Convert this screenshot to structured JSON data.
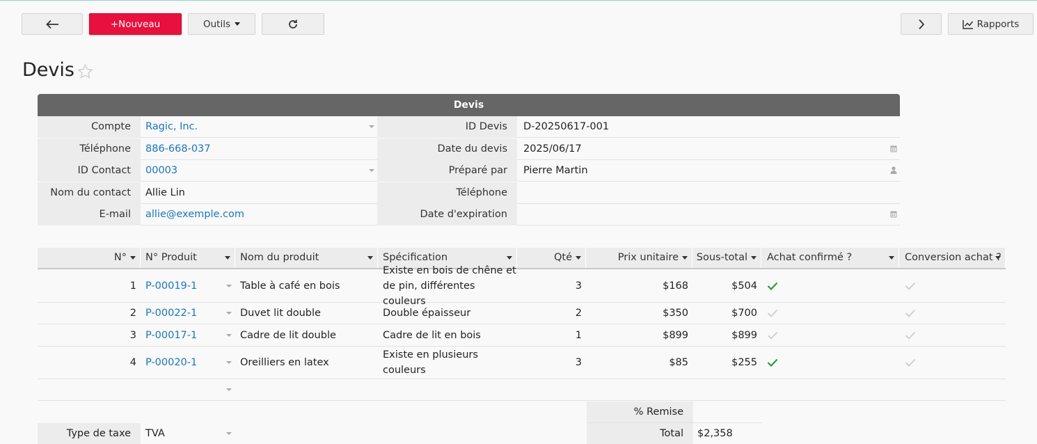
{
  "toolbar": {
    "back_icon": "arrow-left-icon",
    "new_label": "+Nouveau",
    "tools_label": "Outils",
    "refresh_icon": "refresh-icon",
    "next_icon": "chevron-right-icon",
    "reports_label": "Rapports",
    "reports_icon": "line-chart-icon"
  },
  "page": {
    "title": "Devis",
    "favorite_icon": "star-icon"
  },
  "section": {
    "title": "Devis"
  },
  "fields": {
    "compte": {
      "label": "Compte",
      "value": "Ragic, Inc."
    },
    "telephone": {
      "label": "Téléphone",
      "value": "886-668-037"
    },
    "id_contact": {
      "label": "ID Contact",
      "value": "00003"
    },
    "nom_contact": {
      "label": "Nom du contact",
      "value": "Allie Lin"
    },
    "email": {
      "label": "E-mail",
      "value": "allie@exemple.com"
    },
    "id_devis": {
      "label": "ID Devis",
      "value": "D-20250617-001"
    },
    "date_devis": {
      "label": "Date du devis",
      "value": "2025/06/17"
    },
    "prepare_par": {
      "label": "Préparé par",
      "value": "Pierre Martin"
    },
    "telephone2": {
      "label": "Téléphone",
      "value": ""
    },
    "date_expiration": {
      "label": "Date d'expiration",
      "value": ""
    }
  },
  "grid": {
    "headers": [
      "N°",
      "N° Produit",
      "Nom du produit",
      "Spécification",
      "Qté",
      "Prix unitaire",
      "Sous-total",
      "Achat confirmé ?",
      "Conversion achat ?"
    ],
    "rows": [
      {
        "n": "1",
        "produit": "P-00019-1",
        "nom": "Table à café en bois",
        "spec1": "Existe en bois de chêne et",
        "spec2": "de pin, différentes couleurs",
        "qte": "3",
        "prix": "$168",
        "sous_total": "$504",
        "confirme": true,
        "conversion": false
      },
      {
        "n": "2",
        "produit": "P-00022-1",
        "nom": "Duvet lit double",
        "spec1": "Double épaisseur",
        "spec2": "",
        "qte": "2",
        "prix": "$350",
        "sous_total": "$700",
        "confirme": false,
        "conversion": false
      },
      {
        "n": "3",
        "produit": "P-00017-1",
        "nom": "Cadre de lit double",
        "spec1": "Cadre de lit en bois",
        "spec2": "",
        "qte": "1",
        "prix": "$899",
        "sous_total": "$899",
        "confirme": false,
        "conversion": false
      },
      {
        "n": "4",
        "produit": "P-00020-1",
        "nom": "Oreilliers en latex",
        "spec1": "Existe en plusieurs",
        "spec2": "couleurs",
        "qte": "3",
        "prix": "$85",
        "sous_total": "$255",
        "confirme": true,
        "conversion": false
      }
    ]
  },
  "summary": {
    "remise_label": "% Remise",
    "remise_value": "",
    "total_label": "Total",
    "total_value": "$2,358",
    "tax_label": "Type de taxe",
    "tax_value": "TVA"
  },
  "colors": {
    "accent_red": "#e8103c",
    "link_blue": "#1b75bb",
    "check_green": "#2a9a3a",
    "header_gray": "#666666"
  }
}
